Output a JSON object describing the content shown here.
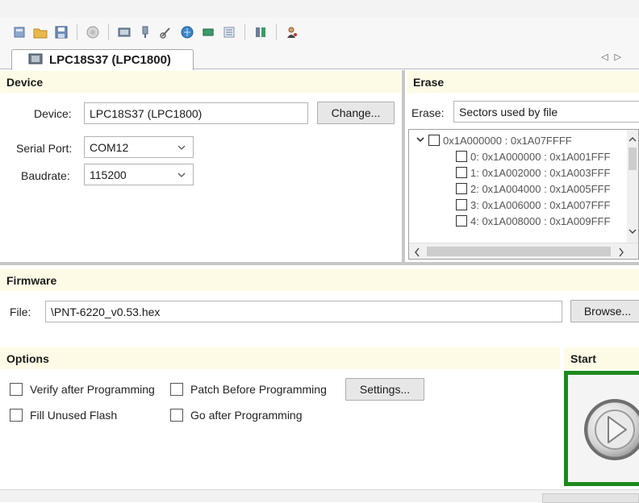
{
  "tab": {
    "title": "LPC18S37 (LPC1800)"
  },
  "device_panel": {
    "header": "Device",
    "device_label": "Device:",
    "device_value": "LPC18S37 (LPC1800)",
    "change_button": "Change...",
    "serial_label": "Serial Port:",
    "serial_value": "COM12",
    "baud_label": "Baudrate:",
    "baud_value": "115200"
  },
  "erase_panel": {
    "header": "Erase",
    "erase_label": "Erase:",
    "erase_value": "Sectors used by file",
    "tree": {
      "root": "0x1A000000 : 0x1A07FFFF",
      "items": [
        "0: 0x1A000000 : 0x1A001FFF",
        "1: 0x1A002000 : 0x1A003FFF",
        "2: 0x1A004000 : 0x1A005FFF",
        "3: 0x1A006000 : 0x1A007FFF",
        "4: 0x1A008000 : 0x1A009FFF"
      ]
    }
  },
  "firmware_panel": {
    "header": "Firmware",
    "file_label": "File:",
    "file_value": "\\PNT-6220_v0.53.hex",
    "browse_button": "Browse..."
  },
  "options_panel": {
    "header": "Options",
    "verify": "Verify after Programming",
    "patch": "Patch Before Programming",
    "settings_button": "Settings...",
    "fill_unused": "Fill Unused Flash",
    "go_after": "Go after Programming"
  },
  "start_panel": {
    "header": "Start"
  },
  "colors": {
    "header_bg": "#fdfbe6",
    "start_border": "#1e8a1e",
    "splitter": "#c7c7c7"
  }
}
